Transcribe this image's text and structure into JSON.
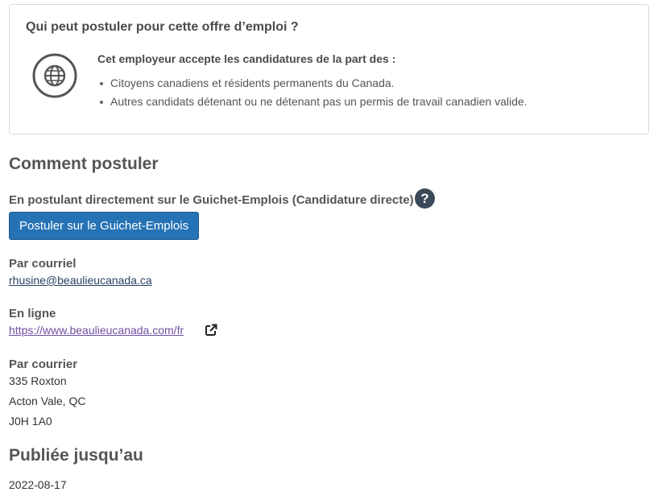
{
  "who_can_apply": {
    "title": "Qui peut postuler pour cette offre d’emploi ?",
    "icon": "globe-icon",
    "heading": "Cet employeur accepte les candidatures de la part des :",
    "items": [
      "Citoyens canadiens et résidents permanents du Canada.",
      "Autres candidats détenant ou ne détenant pas un permis de travail canadien valide."
    ]
  },
  "how_to_apply": {
    "title": "Comment postuler",
    "direct_label": "En postulant directement sur le Guichet-Emplois (Candidature directe)",
    "help_icon": "question-circle-icon",
    "help_glyph": "?",
    "apply_button_label": "Postuler sur le Guichet-Emplois",
    "by_email_label": "Par courriel",
    "email": "rhusine@beaulieucanada.ca",
    "online_label": "En ligne",
    "website": "https://www.beaulieucanada.com/fr",
    "website_icon": "external-link-icon",
    "by_mail_label": "Par courrier",
    "address": [
      "335 Roxton",
      "Acton Vale, QC",
      "J0H 1A0"
    ]
  },
  "posted_until": {
    "title": "Publiée jusqu’au",
    "date": "2022-08-17"
  },
  "colors": {
    "button": "#2572b4",
    "help_icon": "#3b4a59",
    "visited_link": "#6f4fa2",
    "panel_border": "#d9d9d9"
  }
}
